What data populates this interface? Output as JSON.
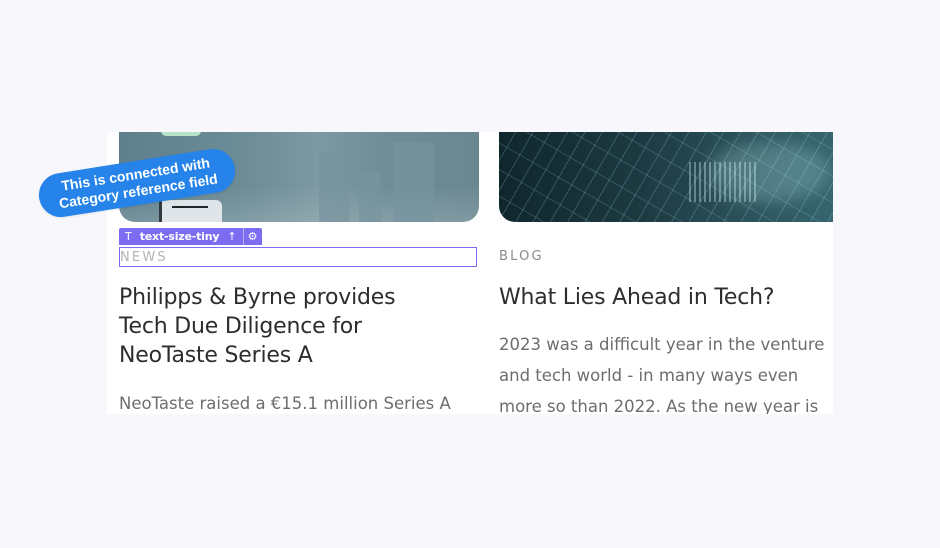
{
  "tooltip": {
    "line1": "This is connected with",
    "line2": "Category reference field"
  },
  "element_chip": {
    "icon": "T",
    "label": "text-size-tiny",
    "arrow": "↑",
    "gear": "⚙"
  },
  "cards": [
    {
      "category": "NEWS",
      "title_lines": [
        "Philipps & Byrne provides",
        "Tech Due Diligence for",
        "NeoTaste Series A"
      ],
      "excerpt_lines": [
        "NeoTaste raised a €15.1 million Series A"
      ]
    },
    {
      "category": "BLOG",
      "title_lines": [
        "What Lies Ahead in Tech?"
      ],
      "excerpt_lines": [
        "2023 was a difficult year in the venture",
        "and tech world - in many ways even",
        "more so than 2022. As the new year is"
      ]
    }
  ],
  "colors": {
    "selection_accent": "#7c6cf2",
    "tooltip_blue": "#2583ea",
    "page_bg": "#f8f7fc"
  }
}
